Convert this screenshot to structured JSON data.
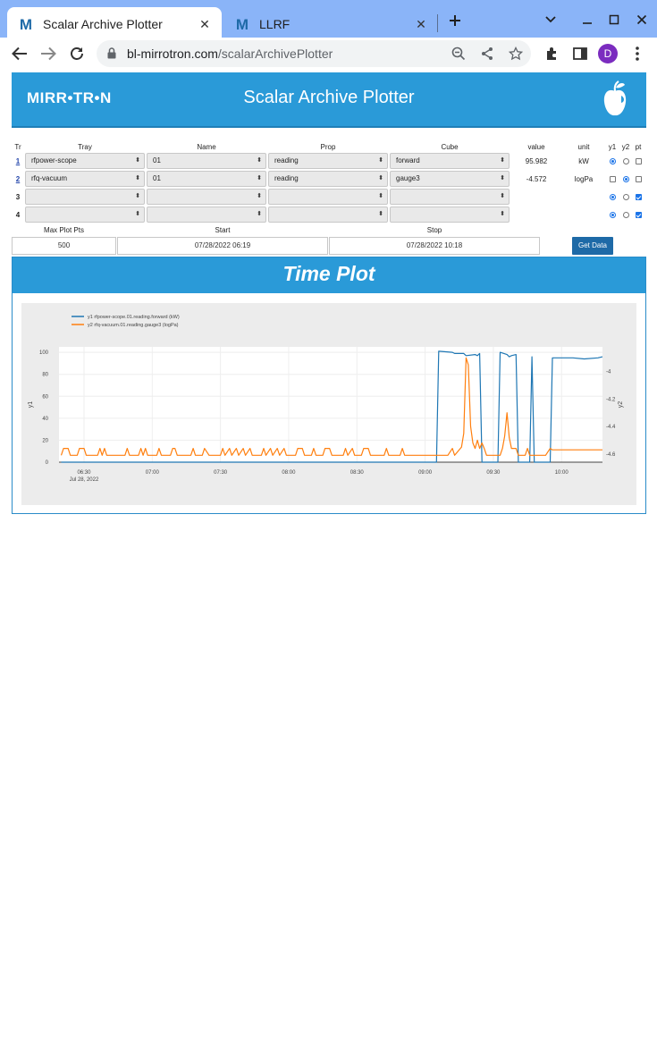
{
  "browser": {
    "tabs": [
      {
        "title": "Scalar Archive Plotter",
        "favicon": "M",
        "active": true
      },
      {
        "title": "LLRF",
        "favicon": "M",
        "active": false
      }
    ],
    "url_host": "bl-mirrotron.com",
    "url_path": "/scalarArchivePlotter",
    "profile_initial": "D"
  },
  "header": {
    "brand": "MIRR•TR•N",
    "title": "Scalar Archive Plotter",
    "logo_icon": "apple-logo-icon"
  },
  "selector": {
    "columns": [
      "Tr",
      "Tray",
      "Name",
      "Prop",
      "Cube",
      "value",
      "unit",
      "y1",
      "y2",
      "pt"
    ],
    "rows": [
      {
        "tr": "1",
        "tray": "rfpower-scope",
        "name": "01",
        "prop": "reading",
        "cube": "forward",
        "value": "95.982",
        "unit": "kW",
        "axis": "y1",
        "pt": false
      },
      {
        "tr": "2",
        "tray": "rfq-vacuum",
        "name": "01",
        "prop": "reading",
        "cube": "gauge3",
        "value": "-4.572",
        "unit": "logPa",
        "axis": "y2",
        "pt": false
      },
      {
        "tr": "3",
        "tray": "",
        "name": "",
        "prop": "",
        "cube": "",
        "value": "",
        "unit": "",
        "axis": "y1",
        "pt": true
      },
      {
        "tr": "4",
        "tray": "",
        "name": "",
        "prop": "",
        "cube": "",
        "value": "",
        "unit": "",
        "axis": "y1",
        "pt": true
      }
    ]
  },
  "query": {
    "max_pts_label": "Max Plot Pts",
    "max_pts": "500",
    "start_label": "Start",
    "start": "07/28/2022 06:19",
    "stop_label": "Stop",
    "stop": "07/28/2022 10:18",
    "button": "Get Data"
  },
  "plot": {
    "heading": "Time Plot"
  },
  "chart_data": {
    "type": "line",
    "x_axis": {
      "type": "time",
      "range": [
        "06:19",
        "10:18"
      ],
      "ticks": [
        "06:30",
        "07:00",
        "07:30",
        "08:00",
        "08:30",
        "09:00",
        "09:30",
        "10:00"
      ],
      "date_label": "Jul 28, 2022"
    },
    "ylabel": "y1",
    "y2label": "y2",
    "ylim": [
      0,
      105
    ],
    "y2lim": [
      -4.66,
      -3.82
    ],
    "yticks": [
      0,
      20,
      40,
      60,
      80,
      100
    ],
    "y2ticks": [
      -4.6,
      -4.4,
      -4.2,
      -4
    ],
    "legend_position": "top-left",
    "grid": true,
    "series": [
      {
        "name": "y1 rfpower-scope.01.reading.forward (kW)",
        "axis": "y1",
        "color": "#1f77b4",
        "points": [
          [
            "06:20",
            0
          ],
          [
            "09:05",
            0
          ],
          [
            "09:06",
            101
          ],
          [
            "09:12",
            100
          ],
          [
            "09:13",
            99
          ],
          [
            "09:17",
            99
          ],
          [
            "09:18",
            97
          ],
          [
            "09:22",
            98
          ],
          [
            "09:23",
            97
          ],
          [
            "09:24",
            99
          ],
          [
            "09:25",
            0
          ],
          [
            "09:32",
            0
          ],
          [
            "09:33",
            100
          ],
          [
            "09:36",
            98
          ],
          [
            "09:37",
            96
          ],
          [
            "09:38",
            97
          ],
          [
            "09:40",
            98
          ],
          [
            "09:41",
            0
          ],
          [
            "09:46",
            0
          ],
          [
            "09:47",
            96
          ],
          [
            "09:48",
            0
          ],
          [
            "09:55",
            0
          ],
          [
            "09:56",
            95
          ],
          [
            "10:05",
            95
          ],
          [
            "10:10",
            94
          ],
          [
            "10:16",
            95
          ],
          [
            "10:18",
            96
          ]
        ]
      },
      {
        "name": "y2 rfq-vacuum.01.reading.gauge3 (logPa)",
        "axis": "y2",
        "color": "#ff7f0e",
        "points": [
          [
            "06:20",
            -4.61
          ],
          [
            "06:21",
            -4.56
          ],
          [
            "06:23",
            -4.56
          ],
          [
            "06:24",
            -4.61
          ],
          [
            "06:27",
            -4.61
          ],
          [
            "06:28",
            -4.56
          ],
          [
            "06:30",
            -4.56
          ],
          [
            "06:31",
            -4.61
          ],
          [
            "06:36",
            -4.61
          ],
          [
            "06:37",
            -4.56
          ],
          [
            "06:38",
            -4.61
          ],
          [
            "06:39",
            -4.56
          ],
          [
            "06:40",
            -4.61
          ],
          [
            "06:48",
            -4.61
          ],
          [
            "06:49",
            -4.56
          ],
          [
            "06:50",
            -4.61
          ],
          [
            "06:54",
            -4.61
          ],
          [
            "06:55",
            -4.56
          ],
          [
            "06:56",
            -4.61
          ],
          [
            "06:57",
            -4.56
          ],
          [
            "06:58",
            -4.61
          ],
          [
            "07:02",
            -4.61
          ],
          [
            "07:03",
            -4.56
          ],
          [
            "07:04",
            -4.61
          ],
          [
            "07:08",
            -4.61
          ],
          [
            "07:09",
            -4.56
          ],
          [
            "07:10",
            -4.56
          ],
          [
            "07:11",
            -4.61
          ],
          [
            "07:17",
            -4.61
          ],
          [
            "07:18",
            -4.56
          ],
          [
            "07:19",
            -4.61
          ],
          [
            "07:22",
            -4.61
          ],
          [
            "07:23",
            -4.56
          ],
          [
            "07:25",
            -4.61
          ],
          [
            "07:30",
            -4.61
          ],
          [
            "07:31",
            -4.56
          ],
          [
            "07:32",
            -4.61
          ],
          [
            "07:34",
            -4.56
          ],
          [
            "07:35",
            -4.61
          ],
          [
            "07:37",
            -4.56
          ],
          [
            "07:38",
            -4.61
          ],
          [
            "07:40",
            -4.56
          ],
          [
            "07:41",
            -4.61
          ],
          [
            "07:43",
            -4.56
          ],
          [
            "07:44",
            -4.61
          ],
          [
            "07:48",
            -4.61
          ],
          [
            "07:49",
            -4.56
          ],
          [
            "07:50",
            -4.61
          ],
          [
            "07:52",
            -4.56
          ],
          [
            "07:53",
            -4.61
          ],
          [
            "07:55",
            -4.56
          ],
          [
            "07:56",
            -4.61
          ],
          [
            "07:58",
            -4.56
          ],
          [
            "07:59",
            -4.61
          ],
          [
            "08:03",
            -4.61
          ],
          [
            "08:04",
            -4.56
          ],
          [
            "08:06",
            -4.56
          ],
          [
            "08:07",
            -4.61
          ],
          [
            "08:10",
            -4.61
          ],
          [
            "08:11",
            -4.56
          ],
          [
            "08:12",
            -4.61
          ],
          [
            "08:15",
            -4.61
          ],
          [
            "08:16",
            -4.56
          ],
          [
            "08:18",
            -4.56
          ],
          [
            "08:19",
            -4.61
          ],
          [
            "08:24",
            -4.61
          ],
          [
            "08:25",
            -4.56
          ],
          [
            "08:26",
            -4.61
          ],
          [
            "08:28",
            -4.56
          ],
          [
            "08:29",
            -4.61
          ],
          [
            "08:32",
            -4.61
          ],
          [
            "08:33",
            -4.56
          ],
          [
            "08:35",
            -4.56
          ],
          [
            "08:36",
            -4.61
          ],
          [
            "08:42",
            -4.61
          ],
          [
            "08:43",
            -4.56
          ],
          [
            "08:44",
            -4.61
          ],
          [
            "08:49",
            -4.61
          ],
          [
            "08:50",
            -4.56
          ],
          [
            "08:51",
            -4.61
          ],
          [
            "09:10",
            -4.61
          ],
          [
            "09:12",
            -4.56
          ],
          [
            "09:13",
            -4.61
          ],
          [
            "09:16",
            -4.55
          ],
          [
            "09:17",
            -4.45
          ],
          [
            "09:18",
            -3.9
          ],
          [
            "09:19",
            -3.95
          ],
          [
            "09:20",
            -4.4
          ],
          [
            "09:21",
            -4.52
          ],
          [
            "09:22",
            -4.56
          ],
          [
            "09:23",
            -4.5
          ],
          [
            "09:24",
            -4.56
          ],
          [
            "09:25",
            -4.52
          ],
          [
            "09:26",
            -4.56
          ],
          [
            "09:27",
            -4.61
          ],
          [
            "09:33",
            -4.61
          ],
          [
            "09:34",
            -4.56
          ],
          [
            "09:35",
            -4.47
          ],
          [
            "09:36",
            -4.3
          ],
          [
            "09:37",
            -4.48
          ],
          [
            "09:38",
            -4.56
          ],
          [
            "09:40",
            -4.56
          ],
          [
            "09:41",
            -4.61
          ],
          [
            "09:44",
            -4.61
          ],
          [
            "09:45",
            -4.56
          ],
          [
            "09:46",
            -4.61
          ],
          [
            "09:53",
            -4.61
          ],
          [
            "09:55",
            -4.56
          ],
          [
            "09:56",
            -4.57
          ],
          [
            "10:18",
            -4.57
          ]
        ]
      }
    ]
  }
}
